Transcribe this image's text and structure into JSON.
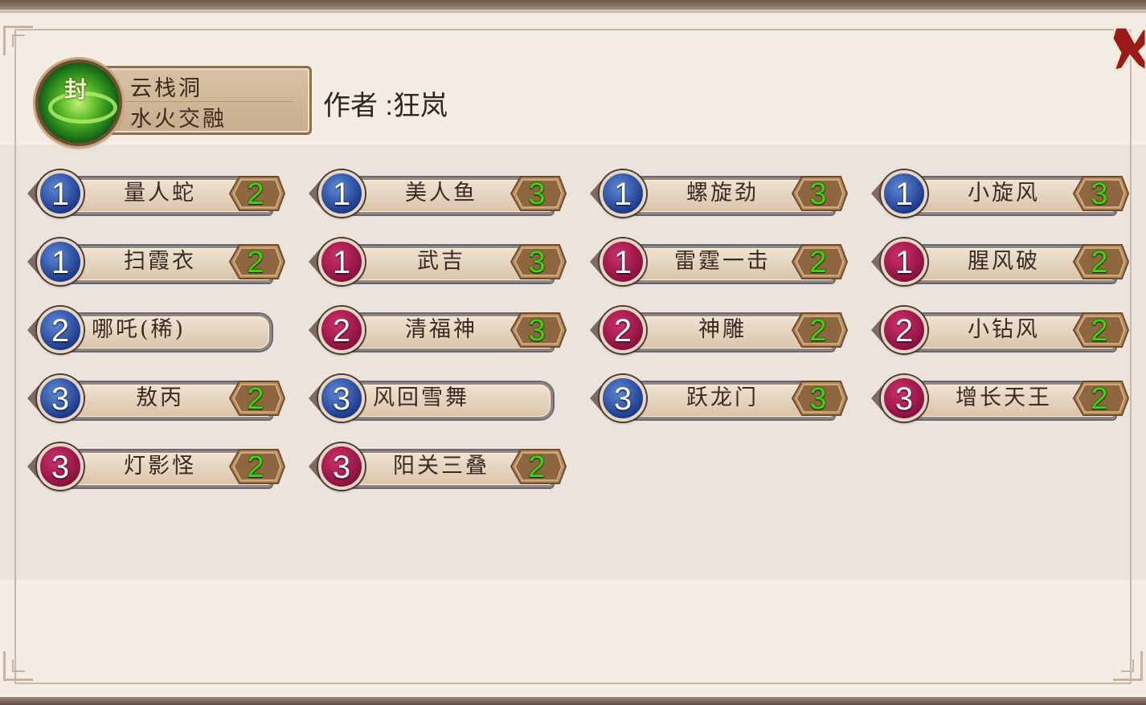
{
  "header": {
    "orb_icon": "seal-orb-icon",
    "orb_char": "封",
    "line1": "云栈洞",
    "line2": "水火交融",
    "author": "作者 :狂岚"
  },
  "close_icon": "close-x-icon",
  "colors": {
    "blue_badge": "#1f3c8c",
    "red_badge": "#8c1240",
    "count_green": "#3cd60e"
  },
  "items": [
    {
      "level": "1",
      "color": "blue",
      "name": "量人蛇",
      "count": "2"
    },
    {
      "level": "1",
      "color": "blue",
      "name": "美人鱼",
      "count": "3"
    },
    {
      "level": "1",
      "color": "blue",
      "name": "螺旋劲",
      "count": "3"
    },
    {
      "level": "1",
      "color": "blue",
      "name": "小旋风",
      "count": "3"
    },
    {
      "level": "1",
      "color": "blue",
      "name": "扫霞衣",
      "count": "2"
    },
    {
      "level": "1",
      "color": "red",
      "name": "武吉",
      "count": "3"
    },
    {
      "level": "1",
      "color": "red",
      "name": "雷霆一击",
      "count": "2"
    },
    {
      "level": "1",
      "color": "red",
      "name": "腥风破",
      "count": "2"
    },
    {
      "level": "2",
      "color": "blue",
      "name": "哪吒(稀)",
      "count": ""
    },
    {
      "level": "2",
      "color": "red",
      "name": "清福神",
      "count": "3"
    },
    {
      "level": "2",
      "color": "red",
      "name": "神雕",
      "count": "2"
    },
    {
      "level": "2",
      "color": "red",
      "name": "小钻风",
      "count": "2"
    },
    {
      "level": "3",
      "color": "blue",
      "name": "敖丙",
      "count": "2"
    },
    {
      "level": "3",
      "color": "blue",
      "name": "风回雪舞",
      "count": ""
    },
    {
      "level": "3",
      "color": "blue",
      "name": "跃龙门",
      "count": "3"
    },
    {
      "level": "3",
      "color": "red",
      "name": "增长天王",
      "count": "2"
    },
    {
      "level": "3",
      "color": "red",
      "name": "灯影怪",
      "count": "2"
    },
    {
      "level": "3",
      "color": "red",
      "name": "阳关三叠",
      "count": "2"
    }
  ]
}
